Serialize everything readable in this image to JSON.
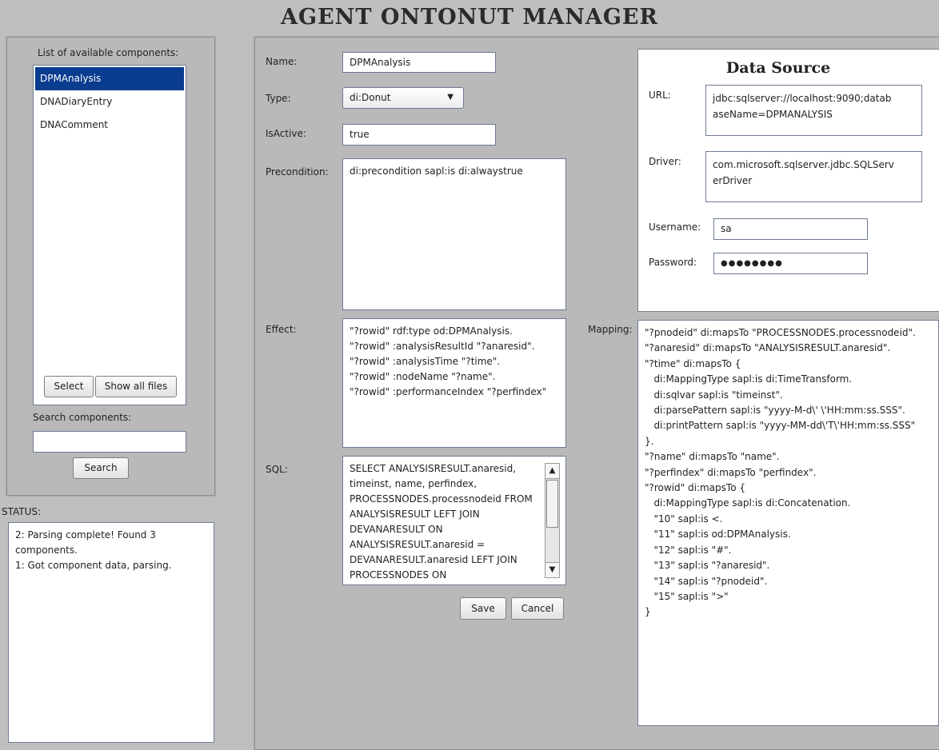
{
  "app": {
    "title": "AGENT ONTONUT MANAGER"
  },
  "components_panel": {
    "heading": "List of available components:",
    "items": [
      {
        "label": "DPMAnalysis",
        "selected": true
      },
      {
        "label": "DNADiaryEntry",
        "selected": false
      },
      {
        "label": "DNAComment",
        "selected": false
      }
    ],
    "select_label": "Select",
    "show_all_label": "Show all files",
    "search_label": "Search components:",
    "search_value": "",
    "search_button": "Search"
  },
  "status": {
    "heading": "STATUS:",
    "lines": [
      "2: Parsing complete! Found 3",
      "components.",
      "1: Got component data, parsing."
    ]
  },
  "form": {
    "name_label": "Name:",
    "name_value": "DPMAnalysis",
    "type_label": "Type:",
    "type_value": "di:Donut",
    "isactive_label": "IsActive:",
    "isactive_value": "true",
    "precondition_label": "Precondition:",
    "precondition_value": "di:precondition sapl:is di:alwaystrue",
    "effect_label": "Effect:",
    "effect_lines": [
      "\"?rowid\" rdf:type od:DPMAnalysis.",
      "\"?rowid\" :analysisResultId \"?anaresid\".",
      "\"?rowid\" :analysisTime \"?time\".",
      "\"?rowid\" :nodeName \"?name\".",
      "\"?rowid\" :performanceIndex \"?perfindex\""
    ],
    "sql_label": "SQL:",
    "sql_lines": [
      "SELECT ANALYSISRESULT.anaresid,",
      "timeinst, name, perfindex,",
      "PROCESSNODES.processnodeid FROM",
      "ANALYSISRESULT LEFT JOIN",
      "DEVANARESULT ON",
      "ANALYSISRESULT.anaresid =",
      "DEVANARESULT.anaresid LEFT JOIN",
      "PROCESSNODES ON"
    ],
    "save_label": "Save",
    "cancel_label": "Cancel"
  },
  "data_source": {
    "heading": "Data Source",
    "url_label": "URL:",
    "url_lines": [
      "jdbc:sqlserver://localhost:9090;datab",
      "aseName=DPMANALYSIS"
    ],
    "driver_label": "Driver:",
    "driver_lines": [
      "com.microsoft.sqlserver.jdbc.SQLServ",
      "erDriver"
    ],
    "username_label": "Username:",
    "username_value": "sa",
    "password_label": "Password:",
    "password_value": "●●●●●●●●"
  },
  "mapping": {
    "label": "Mapping:",
    "lines": [
      "\"?pnodeid\" di:mapsTo \"PROCESSNODES.processnodeid\".",
      "\"?anaresid\" di:mapsTo \"ANALYSISRESULT.anaresid\".",
      "\"?time\" di:mapsTo {",
      "   di:MappingType sapl:is di:TimeTransform.",
      "   di:sqlvar sapl:is \"timeinst\".",
      "   di:parsePattern sapl:is \"yyyy-M-d\\' \\'HH:mm:ss.SSS\".",
      "   di:printPattern sapl:is \"yyyy-MM-dd\\'T\\'HH:mm:ss.SSS\"",
      "}.",
      "\"?name\" di:mapsTo \"name\".",
      "\"?perfindex\" di:mapsTo \"perfindex\".",
      "\"?rowid\" di:mapsTo {",
      "   di:MappingType sapl:is di:Concatenation.",
      "   \"10\" sapl:is <.",
      "   \"11\" sapl:is od:DPMAnalysis.",
      "   \"12\" sapl:is \"#\".",
      "   \"13\" sapl:is \"?anaresid\".",
      "   \"14\" sapl:is \"?pnodeid\".",
      "   \"15\" sapl:is \">\"",
      "}"
    ]
  },
  "colors": {
    "selection": "#0a3c8f",
    "background": "#bfbfbf",
    "panel": "#b9b9b9"
  }
}
